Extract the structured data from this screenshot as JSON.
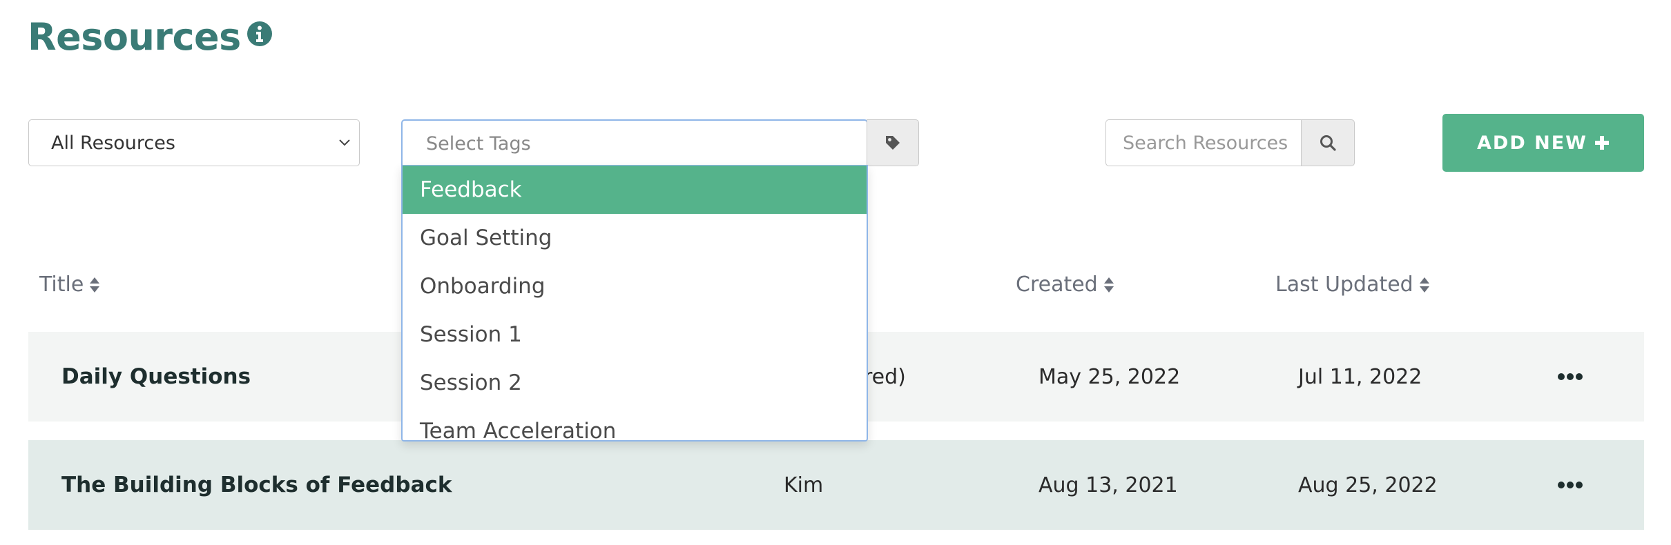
{
  "header": {
    "title": "Resources",
    "info_icon": "info-circle-icon"
  },
  "filters": {
    "resource_select_value": "All Resources",
    "tags_placeholder": "Select Tags",
    "tag_icon": "tag-icon",
    "tag_options": [
      "Feedback",
      "Goal Setting",
      "Onboarding",
      "Session 1",
      "Session 2",
      "Team Acceleration"
    ],
    "highlighted_option": "Feedback",
    "search_placeholder": "Search Resources",
    "search_icon": "search-icon",
    "add_new_label": "ADD NEW",
    "add_new_icon": "plus-icon"
  },
  "table": {
    "columns": {
      "title": "Title",
      "created": "Created",
      "last_updated": "Last Updated"
    },
    "rows": [
      {
        "title": "Daily Questions",
        "owner": "red)",
        "created": "May 25, 2022",
        "last_updated": "Jul 11, 2022",
        "menu_icon": "ellipsis-icon"
      },
      {
        "title": "The Building Blocks of Feedback",
        "owner": "Kim",
        "created": "Aug 13, 2021",
        "last_updated": "Aug 25, 2022",
        "menu_icon": "ellipsis-icon"
      }
    ]
  },
  "colors": {
    "brand": "#3a7b76",
    "accent": "#55b38b",
    "focus_border": "#8fb6e8",
    "row_alt": "#e2ebe9",
    "row": "#f3f5f4"
  }
}
